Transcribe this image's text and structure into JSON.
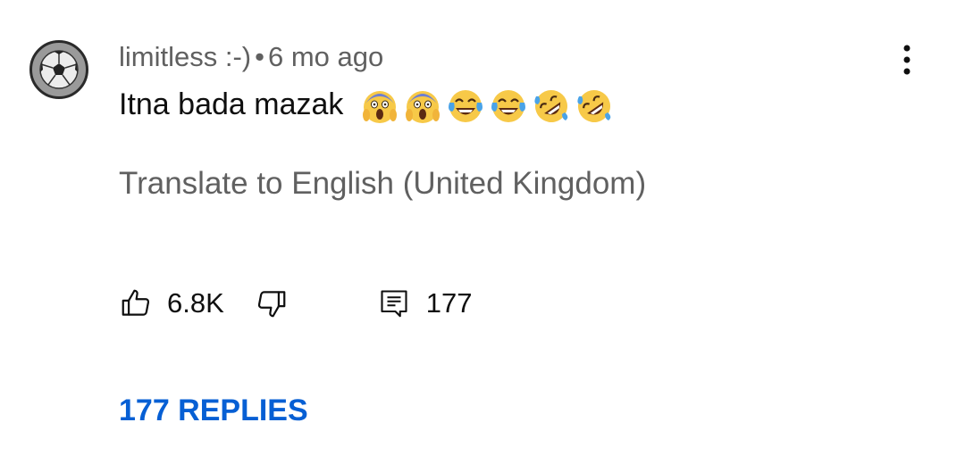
{
  "comment": {
    "author": "limitless :-)",
    "separator": "•",
    "timestamp": "6 mo ago",
    "text": "Itna bada mazak",
    "emojis": [
      "face-screaming-in-fear-emoji",
      "face-screaming-in-fear-emoji",
      "face-with-tears-of-joy-emoji",
      "face-with-tears-of-joy-emoji",
      "rolling-on-the-floor-laughing-emoji",
      "rolling-on-the-floor-laughing-emoji"
    ],
    "translate_label": "Translate to English (United Kingdom)",
    "like_count": "6.8K",
    "reply_count": "177",
    "replies_button": "177 REPLIES"
  },
  "icons": {
    "avatar": "soccer-ball-icon",
    "more": "more-vertical-icon",
    "like": "thumbs-up-icon",
    "dislike": "thumbs-down-icon",
    "reply": "reply-comment-icon"
  },
  "colors": {
    "text_primary": "#0f0f0f",
    "text_secondary": "#606060",
    "link_blue": "#065fd4"
  }
}
